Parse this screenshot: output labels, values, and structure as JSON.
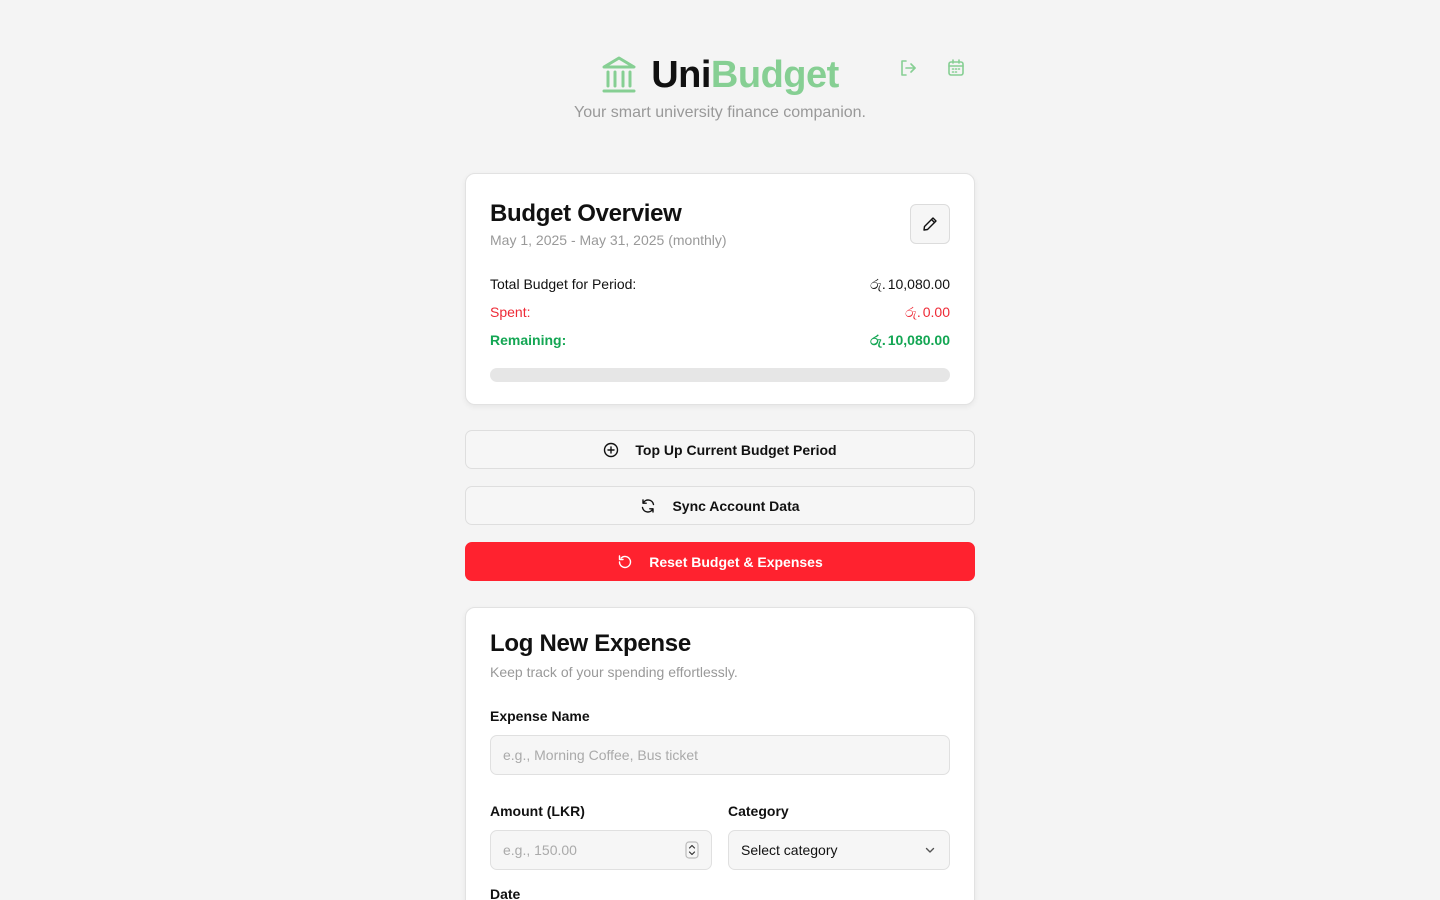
{
  "header": {
    "title_part1": "Uni",
    "title_part2": "Budget",
    "tagline": "Your smart university finance companion.",
    "icons": [
      "bank-icon",
      "logout-icon",
      "calendar-icon"
    ]
  },
  "colors": {
    "accent": "#86cf93",
    "danger": "#ff222f",
    "success": "#13a653",
    "spent": "#ee2a36"
  },
  "overview": {
    "title": "Budget Overview",
    "period": "May 1, 2025 - May 31, 2025 (monthly)",
    "total_label": "Total Budget for Period:",
    "total_value": "10,080.00",
    "spent_label": "Spent:",
    "spent_value": "0.00",
    "remaining_label": "Remaining:",
    "remaining_value": "10,080.00",
    "currency_symbol": "රු.",
    "spent_fraction": 0
  },
  "actions": {
    "topup_label": "Top Up Current Budget Period",
    "sync_label": "Sync Account Data",
    "reset_label": "Reset Budget & Expenses"
  },
  "expense_form": {
    "title": "Log New Expense",
    "subtitle": "Keep track of your spending effortlessly.",
    "name_label": "Expense Name",
    "name_placeholder": "e.g., Morning Coffee, Bus ticket",
    "amount_label": "Amount (LKR)",
    "amount_placeholder": "e.g., 150.00",
    "category_label": "Category",
    "category_value": "Select category",
    "date_label": "Date"
  }
}
